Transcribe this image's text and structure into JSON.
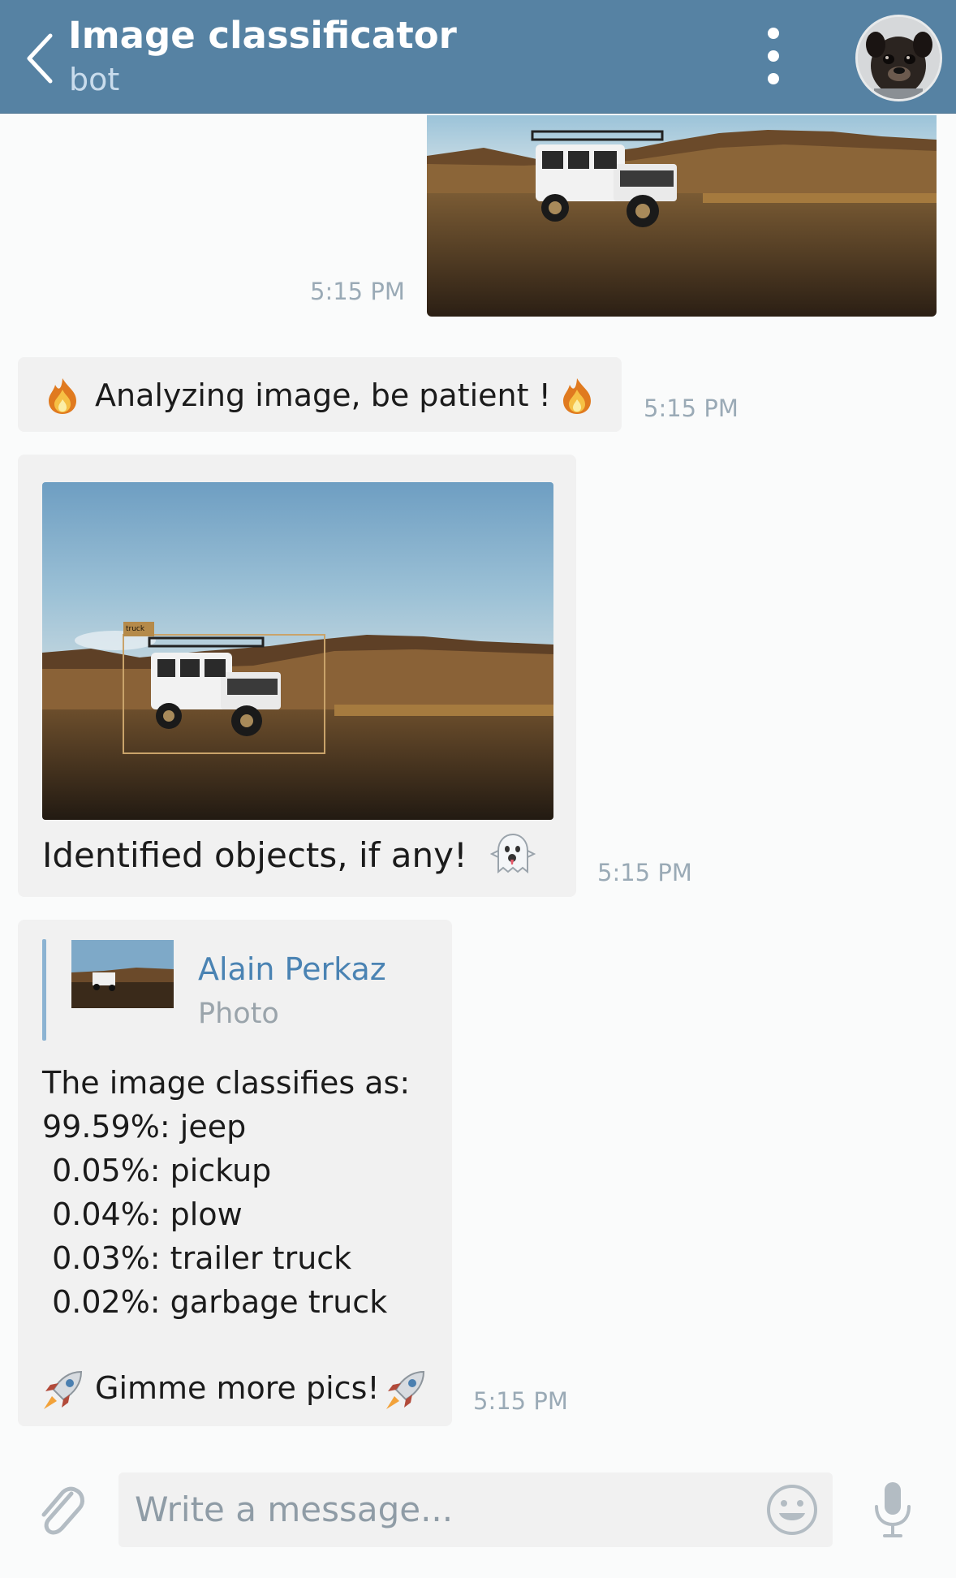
{
  "header": {
    "title": "Image classificator",
    "subtitle": "bot",
    "back_icon": "chevron-left-icon",
    "menu_icon": "more-vertical-icon",
    "avatar_icon": "pug-avatar"
  },
  "messages": [
    {
      "type": "outgoing-photo",
      "time": "5:15 PM"
    },
    {
      "type": "incoming-text",
      "text": "Analyzing image, be patient !",
      "emoji": "fire",
      "time": "5:15 PM"
    },
    {
      "type": "incoming-photo",
      "box_label": "truck",
      "caption": "Identified objects, if any!",
      "emoji": "ghost",
      "time": "5:15 PM"
    },
    {
      "type": "incoming-reply",
      "reply_to": {
        "name": "Alain Perkaz",
        "kind": "Photo"
      },
      "lines": [
        "The image classifies as:",
        "99.59%: jeep",
        " 0.05%: pickup",
        " 0.04%: plow",
        " 0.03%: trailer truck",
        " 0.02%: garbage truck"
      ],
      "footer": "Gimme more pics!",
      "emoji": "rocket",
      "time": "5:15 PM"
    }
  ],
  "composer": {
    "placeholder": "Write a message...",
    "attach_icon": "paperclip-icon",
    "emoji_icon": "smiley-icon",
    "mic_icon": "microphone-icon"
  },
  "colors": {
    "header": "#5682a3",
    "bubble": "#f1f1f1",
    "time": "#9aaab6",
    "link": "#4a83b3"
  }
}
